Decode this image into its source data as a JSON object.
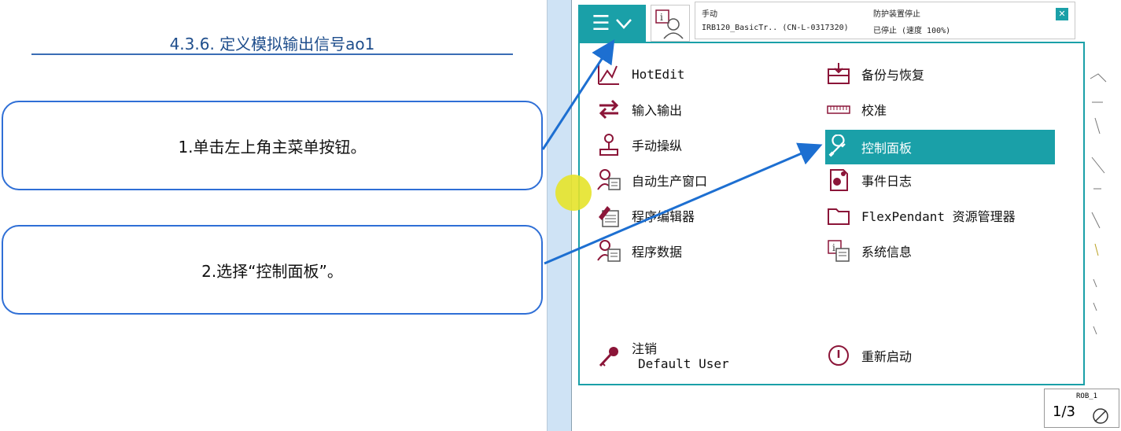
{
  "slide": {
    "title": "4.3.6. 定义模拟输出信号ao1",
    "steps": [
      "1.单击左上角主菜单按钮。",
      "2.选择“控制面板”。"
    ]
  },
  "status": {
    "mode": "手动",
    "controller": "IRB120_BasicTr.. (CN-L-0317320)",
    "safety": "防护装置停止",
    "speed": "已停止 (速度 100%)"
  },
  "menu": {
    "left": [
      {
        "label": "HotEdit",
        "icon": "hotedit-icon"
      },
      {
        "label": "输入输出",
        "icon": "io-icon"
      },
      {
        "label": "手动操纵",
        "icon": "joystick-icon"
      },
      {
        "label": "自动生产窗口",
        "icon": "production-window-icon"
      },
      {
        "label": "程序编辑器",
        "icon": "program-editor-icon"
      },
      {
        "label": "程序数据",
        "icon": "program-data-icon"
      }
    ],
    "right": [
      {
        "label": "备份与恢复",
        "icon": "backup-icon"
      },
      {
        "label": "校准",
        "icon": "calibration-icon"
      },
      {
        "label": "控制面板",
        "icon": "wrench-icon",
        "selected": true
      },
      {
        "label": "事件日志",
        "icon": "event-log-icon"
      },
      {
        "label": "FlexPendant 资源管理器",
        "icon": "folder-icon"
      },
      {
        "label": "系统信息",
        "icon": "system-info-icon"
      }
    ],
    "logout": {
      "label": "注销",
      "user": "Default User"
    },
    "restart": {
      "label": "重新启动"
    }
  },
  "quickset": {
    "robot": "ROB_1",
    "speed_fraction": "1/3"
  },
  "colors": {
    "accent": "#1aa0a8",
    "icon": "#8b1538",
    "arrow": "#1d6fd1",
    "box_border": "#2f6fd6"
  }
}
